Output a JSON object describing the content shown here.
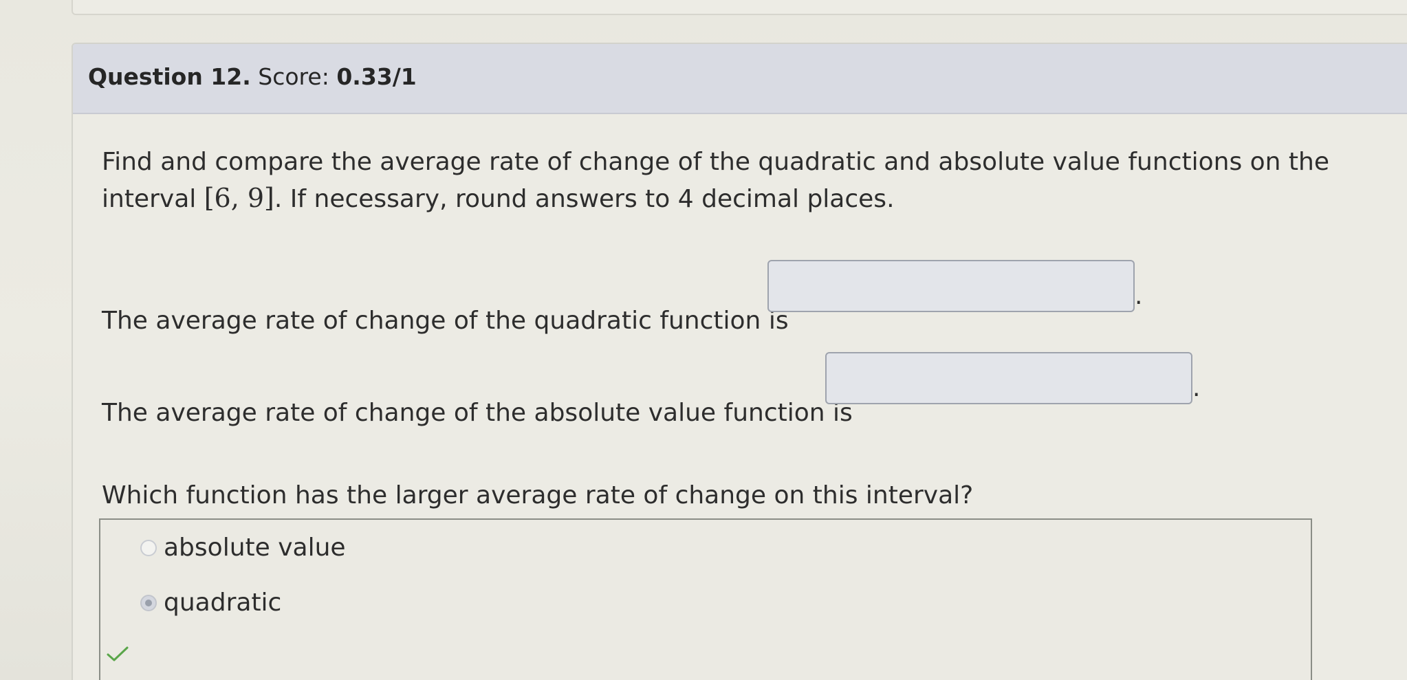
{
  "question": {
    "number_label": "Question 12.",
    "score_label": "Score:",
    "score_value": "0.33/1"
  },
  "prompt": {
    "text_before": "Find and compare the average rate of change of the quadratic and absolute value functions on the interval ",
    "interval": "[6, 9]",
    "text_after": ". If necessary, round answers to 4 decimal places."
  },
  "answers": {
    "quadratic_label": "The average rate of change of the quadratic function is",
    "quadratic_value": "",
    "absolute_label": "The average rate of change of the absolute value function is",
    "absolute_value": "",
    "period": "."
  },
  "multiple_choice": {
    "question": "Which function has the larger average rate of change on this interval?",
    "options": [
      {
        "label": "absolute value",
        "selected": false
      },
      {
        "label": "quadratic",
        "selected": true
      }
    ],
    "status": "correct"
  },
  "colors": {
    "header_bg": "#d9dbe3",
    "input_bg": "#e3e5ea",
    "check_green": "#5aa64a"
  },
  "icons": {
    "check": "check-icon",
    "radio_empty": "radio-unselected-icon",
    "radio_filled": "radio-selected-icon"
  }
}
